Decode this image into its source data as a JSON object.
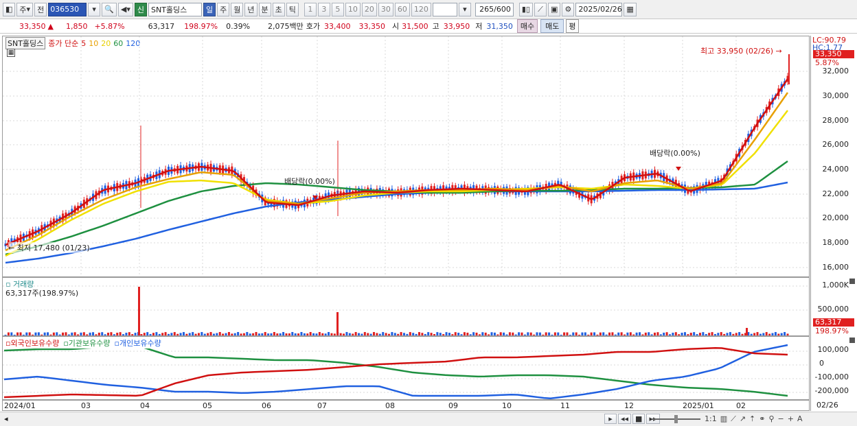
{
  "toolbar": {
    "type_label": "주",
    "prev_label": "전",
    "stock_code": "036530",
    "stock_name": "SNT홀딩스",
    "new_label": "신",
    "periods": [
      "일",
      "주",
      "월",
      "년",
      "분",
      "초",
      "틱"
    ],
    "active_period": "일",
    "intervals": [
      "1",
      "3",
      "5",
      "10",
      "20",
      "30",
      "60",
      "120"
    ],
    "count": "265",
    "count_max": "/600",
    "date": "2025/02/26"
  },
  "quote": {
    "price": "33,350",
    "change_arrow": "▲",
    "change": "1,850",
    "change_pct": "+5.87%",
    "volume": "63,317",
    "volume_ratio": "198.97%",
    "turnover": "0.39%",
    "amount": "2,075백만",
    "bid_label": "호가",
    "bid_ask": "33,400",
    "bid_bid": "33,350",
    "open_label": "시",
    "open": "31,500",
    "high_label": "고",
    "high": "33,950",
    "low_label": "저",
    "low": "31,350",
    "buy_label": "매수",
    "sell_label": "매도",
    "avg_label": "평"
  },
  "price_panel": {
    "name_tag": "SNT홀딩스",
    "ma_title": "종가 단순",
    "ma_periods": [
      "5",
      "10",
      "20",
      "60",
      "120"
    ],
    "ma_colors": [
      "#d01010",
      "#e8a000",
      "#f0e000",
      "#1e9040",
      "#2060e0"
    ],
    "lc": "LC:90.79",
    "hc": "HC:1.77",
    "high_note": "최고 33,950 (02/26)",
    "low_note": "최저 17,480 (01/23)",
    "dividend_note_1": "배당락(0.00%)",
    "dividend_note_2": "배당락(0.00%)",
    "last_price_flag": "33,350",
    "last_pct_flag": "5.87%",
    "y_ticks": [
      "32,000",
      "30,000",
      "28,000",
      "26,000",
      "24,000",
      "22,000",
      "20,000",
      "18,000",
      "16,000"
    ]
  },
  "volume_panel": {
    "title": "거래량",
    "value": "63,317주(198.97%)",
    "y_ticks": [
      "1,000K",
      "500,000"
    ],
    "last_flag": "63,317",
    "last_pct": "198.97%"
  },
  "holdings_panel": {
    "legend": [
      "외국인보유수량",
      "기관보유수량",
      "개인보유수량"
    ],
    "legend_colors": [
      "#d01010",
      "#1e9040",
      "#2060e0"
    ],
    "y_ticks": [
      "100,000",
      "0",
      "-100,000",
      "-200,000"
    ]
  },
  "x_axis": {
    "labels": [
      "2024/01",
      "03",
      "04",
      "05",
      "06",
      "07",
      "08",
      "09",
      "10",
      "11",
      "12",
      "2025/01",
      "02"
    ],
    "last_date": "02/26"
  },
  "status": {
    "ratio_label": "1:1"
  }
}
